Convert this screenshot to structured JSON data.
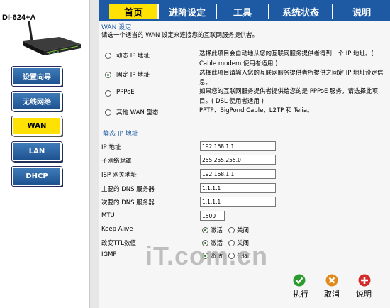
{
  "device": {
    "model": "DI-624+A"
  },
  "sidebar": {
    "items": [
      {
        "label": "设置向导",
        "active": false
      },
      {
        "label": "无线网络",
        "active": false
      },
      {
        "label": "WAN",
        "active": true
      },
      {
        "label": "LAN",
        "active": false
      },
      {
        "label": "DHCP",
        "active": false
      }
    ]
  },
  "topnav": {
    "tabs": [
      {
        "label": "首页",
        "active": true
      },
      {
        "label": "进阶设定",
        "active": false
      },
      {
        "label": "工具",
        "active": false
      },
      {
        "label": "系统状态",
        "active": false
      },
      {
        "label": "说明",
        "active": false
      }
    ]
  },
  "wan": {
    "title": "WAN 设定",
    "intro": "请选一个适当的 WAN 设定来连接您的互联网服务提供者。",
    "options": [
      {
        "label": "动态 IP 地址",
        "selected": false,
        "desc": "选择此项目会自动地从您的互联网服务提供者得到一个 IP 地址。( Cable modem 使用者适用 )"
      },
      {
        "label": "固定 IP 地址",
        "selected": true,
        "desc": "选择此项目请输入您的互联网服务提供者所提供之固定 IP 地址设定信息。"
      },
      {
        "label": "PPPoE",
        "selected": false,
        "desc": "如果您的互联网服务提供者提供给您的是 PPPoE 服务，请选择此项目。( DSL 使用者适用 )"
      },
      {
        "label": "其他 WAN 型态",
        "selected": false,
        "desc": "PPTP、BigPond Cable、L2TP 和 Telia。"
      }
    ]
  },
  "static_ip": {
    "title": "静态 IP 地址",
    "fields": [
      {
        "label": "IP 地址",
        "value": "192.168.1.1"
      },
      {
        "label": "子网络遮罩",
        "value": "255.255.255.0"
      },
      {
        "label": "ISP 网关地址",
        "value": "192.168.1.1"
      },
      {
        "label": "主要的 DNS 服务器",
        "value": "1.1.1.1"
      },
      {
        "label": "次要的 DNS 服务器",
        "value": "1.1.1.1"
      },
      {
        "label": "MTU",
        "value": "1500"
      }
    ],
    "toggles": [
      {
        "label": "Keep Alive",
        "on_label": "激活",
        "off_label": "关闭",
        "value": "激活"
      },
      {
        "label": "改变TTL数值",
        "on_label": "激活",
        "off_label": "关闭",
        "value": "激活"
      },
      {
        "label": "IGMP",
        "on_label": "激活",
        "off_label": "关闭",
        "value": "激活"
      }
    ]
  },
  "actions": {
    "apply": {
      "label": "执行",
      "icon": "check-icon",
      "color": "#2e9b2e"
    },
    "cancel": {
      "label": "取消",
      "icon": "cross-icon",
      "color": "#e08a1c"
    },
    "help": {
      "label": "说明",
      "icon": "plus-icon",
      "color": "#d42a2a"
    }
  },
  "watermark": "iT.com.cn",
  "colors": {
    "nav_blue": "#1d5aa3",
    "active_yellow": "#ffe203",
    "sidebar_blue": "#2e6aad"
  }
}
